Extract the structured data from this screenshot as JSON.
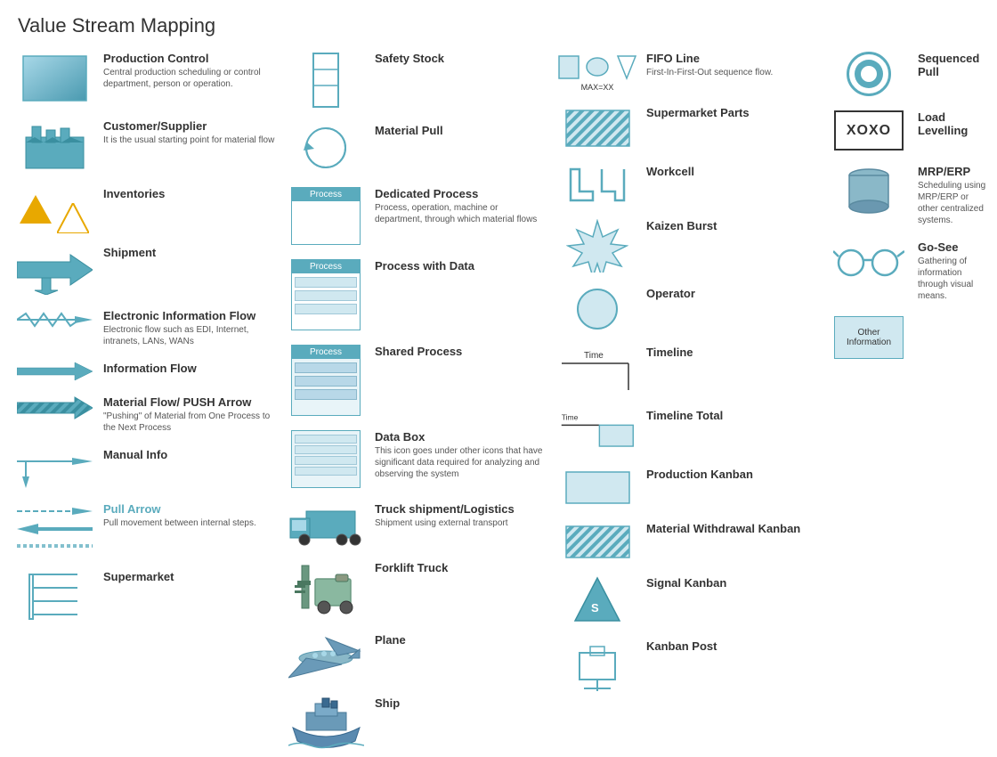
{
  "title": "Value Stream Mapping",
  "columns": {
    "col1": {
      "items": [
        {
          "id": "production-control",
          "label": "Production Control",
          "desc": "Central production scheduling or control department, person or operation."
        },
        {
          "id": "customer-supplier",
          "label": "Customer/Supplier",
          "desc": "It is the usual starting point for material flow"
        },
        {
          "id": "inventories",
          "label": "Inventories",
          "desc": ""
        },
        {
          "id": "shipment",
          "label": "Shipment",
          "desc": ""
        },
        {
          "id": "electronic-info-flow",
          "label": "Electronic Information Flow",
          "desc": "Electronic flow such as EDI, Internet, intranets, LANs, WANs"
        },
        {
          "id": "information-flow",
          "label": "Information Flow",
          "desc": ""
        },
        {
          "id": "material-flow",
          "label": "Material Flow/ PUSH Arrow",
          "desc": "\"Pushing\" of Material from One Process to the Next Process"
        },
        {
          "id": "manual-info",
          "label": "Manual Info",
          "desc": ""
        },
        {
          "id": "pull-arrow",
          "label": "Pull Arrow",
          "desc": "Pull movement between internal steps."
        },
        {
          "id": "supermarket",
          "label": "Supermarket",
          "desc": ""
        }
      ]
    },
    "col2": {
      "items": [
        {
          "id": "safety-stock",
          "label": "Safety Stock",
          "desc": ""
        },
        {
          "id": "material-pull",
          "label": "Material Pull",
          "desc": ""
        },
        {
          "id": "dedicated-process",
          "label": "Dedicated Process",
          "desc": "Process, operation, machine or department, through which material flows"
        },
        {
          "id": "process-with-data",
          "label": "Process with Data",
          "desc": ""
        },
        {
          "id": "shared-process",
          "label": "Shared Process",
          "desc": ""
        },
        {
          "id": "data-box",
          "label": "Data Box",
          "desc": "This icon goes under other icons that have significant data required for analyzing and observing the system"
        },
        {
          "id": "truck-shipment",
          "label": "Truck shipment/Logistics",
          "desc": "Shipment using external transport"
        },
        {
          "id": "forklift-truck",
          "label": "Forklift Truck",
          "desc": ""
        },
        {
          "id": "plane",
          "label": "Plane",
          "desc": ""
        },
        {
          "id": "ship",
          "label": "Ship",
          "desc": ""
        }
      ]
    },
    "col3": {
      "items": [
        {
          "id": "fifo-line",
          "label": "FIFO Line",
          "desc": "First-In-First-Out sequence flow.",
          "sublabel": "MAX=XX"
        },
        {
          "id": "supermarket-parts",
          "label": "Supermarket Parts",
          "desc": ""
        },
        {
          "id": "workcell",
          "label": "Workcell",
          "desc": ""
        },
        {
          "id": "kaizen-burst",
          "label": "Kaizen Burst",
          "desc": ""
        },
        {
          "id": "operator",
          "label": "Operator",
          "desc": ""
        },
        {
          "id": "timeline",
          "label": "Timeline",
          "desc": "",
          "timelabel": "Time"
        },
        {
          "id": "timeline-total",
          "label": "Timeline Total",
          "desc": "",
          "timelabel": "Time"
        },
        {
          "id": "production-kanban",
          "label": "Production Kanban",
          "desc": ""
        },
        {
          "id": "material-withdrawal",
          "label": "Material Withdrawal Kanban",
          "desc": ""
        },
        {
          "id": "signal-kanban",
          "label": "Signal Kanban",
          "desc": ""
        },
        {
          "id": "kanban-post",
          "label": "Kanban Post",
          "desc": ""
        }
      ]
    },
    "col4": {
      "items": [
        {
          "id": "sequenced-pull",
          "label": "Sequenced Pull",
          "desc": ""
        },
        {
          "id": "load-levelling",
          "label": "Load Levelling",
          "desc": ""
        },
        {
          "id": "mrp-erp",
          "label": "MRP/ERP",
          "desc": "Scheduling using MRP/ERP or other centralized systems."
        },
        {
          "id": "go-see",
          "label": "Go-See",
          "desc": "Gathering of information through visual means."
        },
        {
          "id": "other-information",
          "label": "Other Information",
          "desc": ""
        }
      ]
    }
  }
}
